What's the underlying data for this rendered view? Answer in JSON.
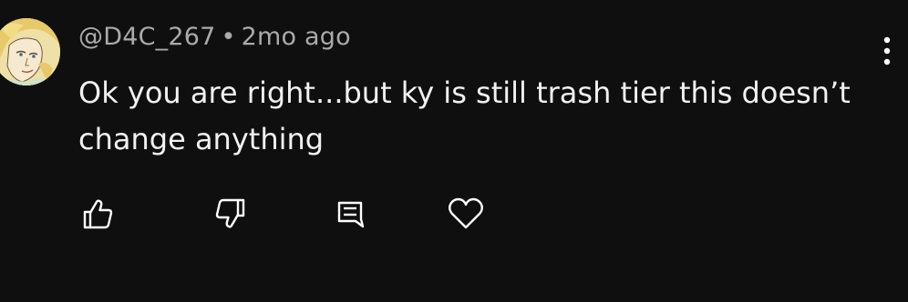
{
  "comment": {
    "author": "@D4C_267",
    "separator": "•",
    "timestamp": "2mo ago",
    "text_line1": "Ok you are right...but ky is still trash tier this doesn’t",
    "text_line2": "change anything",
    "avatar": "avatar-character-portrait"
  },
  "menu": {
    "icon": "more-vert-icon"
  },
  "actions": {
    "like_icon": "thumbs-up-icon",
    "dislike_icon": "thumbs-down-icon",
    "reply_icon": "reply-comment-icon",
    "heart_icon": "heart-icon"
  },
  "colors": {
    "background": "#0f0f0f",
    "text": "#f1f1f1",
    "secondary_text": "#aaaaaa",
    "icon": "#ffffff"
  }
}
